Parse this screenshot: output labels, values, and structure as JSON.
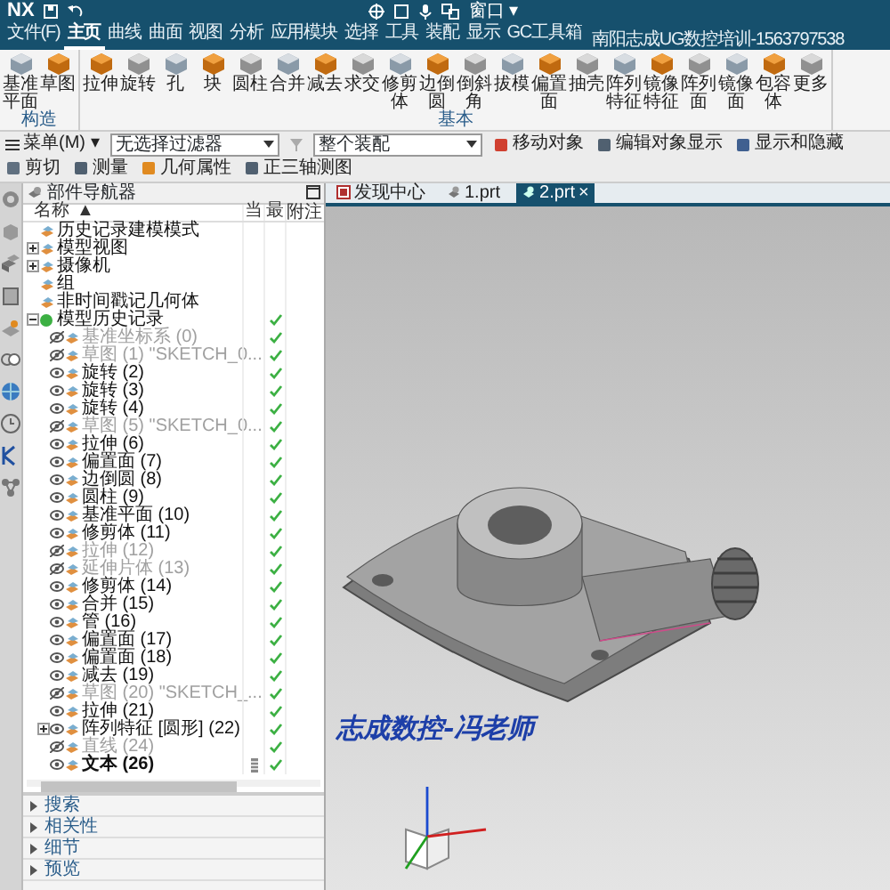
{
  "title_bar": {
    "logo": "NX",
    "window_menu": "窗口 ▾"
  },
  "menu_tabs": [
    {
      "label": "文件(F)",
      "selected": false
    },
    {
      "label": "主页",
      "selected": true
    },
    {
      "label": "曲线",
      "selected": false
    },
    {
      "label": "曲面",
      "selected": false
    },
    {
      "label": "视图",
      "selected": false
    },
    {
      "label": "分析",
      "selected": false
    },
    {
      "label": "应用模块",
      "selected": false
    },
    {
      "label": "选择",
      "selected": false
    },
    {
      "label": "工具",
      "selected": false
    },
    {
      "label": "装配",
      "selected": false
    },
    {
      "label": "显示",
      "selected": false
    },
    {
      "label": "GC工具箱",
      "selected": false
    }
  ],
  "app_title": "南阳志成UG数控培训-1563797538",
  "ribbon": [
    {
      "label": "构造",
      "tools": [
        "基准平面",
        "草图"
      ]
    },
    {
      "label": "基本",
      "tools": [
        "拉伸",
        "旋转",
        "孔",
        "块",
        "圆柱",
        "合并",
        "减去",
        "求交",
        "修剪体",
        "边倒圆",
        "倒斜角",
        "拔模",
        "偏置面",
        "抽壳",
        "阵列特征",
        "镜像特征",
        "阵列面",
        "镜像面",
        "包容体",
        "更多"
      ]
    }
  ],
  "toolbar": {
    "menu": "菜单(M) ▾",
    "filter": "无选择过滤器",
    "scope": "整个装配",
    "commands": [
      "移动对象",
      "编辑对象显示",
      "显示和隐藏",
      "剪切",
      "测量",
      "几何属性",
      "正三轴测图"
    ]
  },
  "navigator": {
    "title": "部件导航器",
    "columns": [
      "名称",
      "当",
      "最",
      "附注"
    ],
    "sort_mark": "▲",
    "tree": [
      {
        "label": "历史记录建模模式"
      },
      {
        "label": "模型视图",
        "expanded": false
      },
      {
        "label": "摄像机",
        "expanded": false
      },
      {
        "label": "组"
      },
      {
        "label": "非时间戳记几何体"
      },
      {
        "label": "模型历史记录",
        "expanded": true,
        "latest": true,
        "children": [
          {
            "label": "基准坐标系 (0)",
            "suppressed": true,
            "latest": true
          },
          {
            "label": "草图 (1) \"SKETCH_0...",
            "suppressed": true,
            "latest": true
          },
          {
            "label": "旋转 (2)",
            "suppressed": false,
            "latest": true
          },
          {
            "label": "旋转 (3)",
            "suppressed": false,
            "latest": true
          },
          {
            "label": "旋转 (4)",
            "suppressed": false,
            "latest": true
          },
          {
            "label": "草图 (5) \"SKETCH_0...",
            "suppressed": true,
            "latest": true
          },
          {
            "label": "拉伸 (6)",
            "suppressed": false,
            "latest": true
          },
          {
            "label": "偏置面 (7)",
            "suppressed": false,
            "latest": true
          },
          {
            "label": "边倒圆 (8)",
            "suppressed": false,
            "latest": true
          },
          {
            "label": "圆柱 (9)",
            "suppressed": false,
            "latest": true
          },
          {
            "label": "基准平面 (10)",
            "suppressed": false,
            "latest": true
          },
          {
            "label": "修剪体 (11)",
            "suppressed": false,
            "latest": true
          },
          {
            "label": "拉伸 (12)",
            "suppressed": true,
            "latest": true
          },
          {
            "label": "延伸片体 (13)",
            "suppressed": true,
            "latest": true
          },
          {
            "label": "修剪体 (14)",
            "suppressed": false,
            "latest": true
          },
          {
            "label": "合并 (15)",
            "suppressed": false,
            "latest": true
          },
          {
            "label": "管 (16)",
            "suppressed": false,
            "latest": true
          },
          {
            "label": "偏置面 (17)",
            "suppressed": false,
            "latest": true
          },
          {
            "label": "偏置面 (18)",
            "suppressed": false,
            "latest": true
          },
          {
            "label": "减去 (19)",
            "suppressed": false,
            "latest": true
          },
          {
            "label": "草图 (20) \"SKETCH_...",
            "suppressed": true,
            "latest": true
          },
          {
            "label": "拉伸 (21)",
            "suppressed": false,
            "latest": true
          },
          {
            "label": "阵列特征 [圆形] (22)",
            "expanded": false,
            "suppressed": false,
            "latest": true
          },
          {
            "label": "直线 (24)",
            "suppressed": true,
            "latest": true
          },
          {
            "label": "文本 (26)",
            "suppressed": false,
            "latest": true,
            "current": true
          }
        ]
      }
    ],
    "sections": [
      "搜索",
      "相关性",
      "细节",
      "预览"
    ]
  },
  "doc_tabs": [
    {
      "label": "发现中心",
      "selected": false
    },
    {
      "label": "1.prt",
      "selected": false
    },
    {
      "label": "2.prt",
      "selected": true,
      "close": "×"
    }
  ],
  "viewport": {
    "text_feature": "志成数控-冯老师"
  }
}
